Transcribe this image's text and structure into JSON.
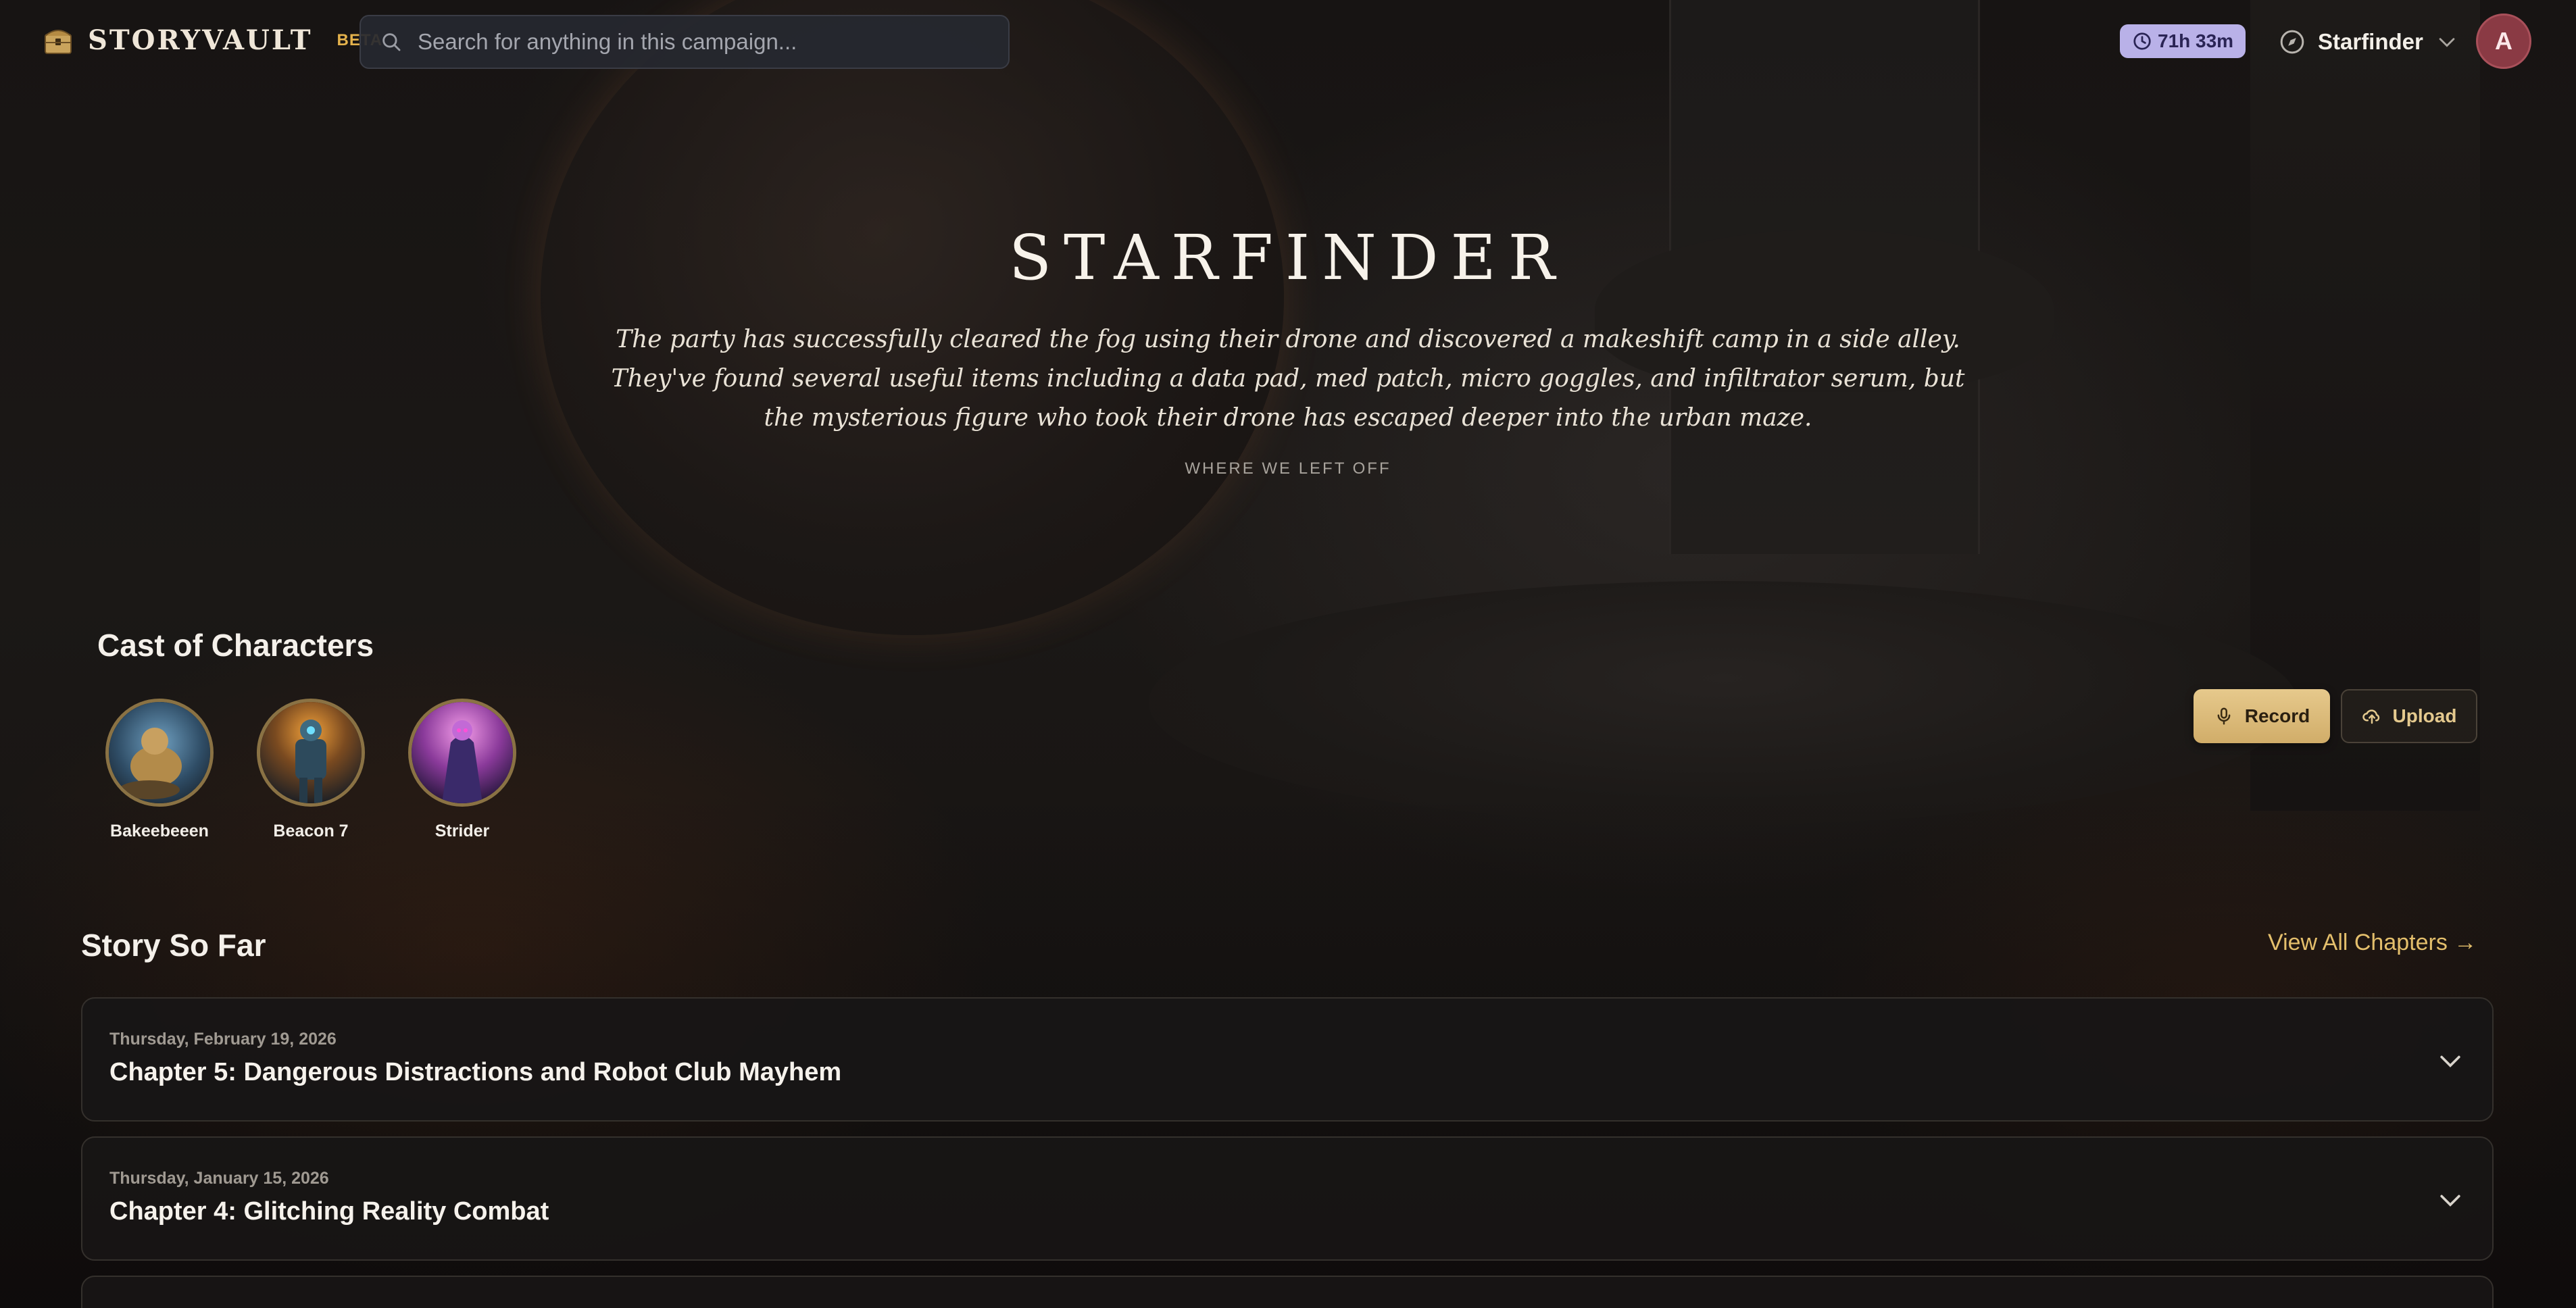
{
  "app": {
    "name": "STORYVAULT",
    "badge": "BETA"
  },
  "search": {
    "placeholder": "Search for anything in this campaign..."
  },
  "header": {
    "time_remaining": "71h 33m",
    "campaign_selector": "Starfinder",
    "user_initial": "A"
  },
  "hero": {
    "title": "STARFINDER",
    "summary": "The party has successfully cleared the fog using their drone and discovered a makeshift camp in a side alley. They've found several useful items including a data pad, med patch, micro goggles, and infiltrator serum, but the mysterious figure who took their drone has escaped deeper into the urban maze.",
    "caption": "WHERE WE LEFT OFF"
  },
  "cast": {
    "heading": "Cast of Characters",
    "characters": [
      {
        "name": "Bakeebeeen"
      },
      {
        "name": "Beacon 7"
      },
      {
        "name": "Strider"
      }
    ]
  },
  "actions": {
    "record": "Record",
    "upload": "Upload"
  },
  "story": {
    "heading": "Story So Far",
    "view_all": "View All Chapters →",
    "chapters": [
      {
        "date": "Thursday, February 19, 2026",
        "title": "Chapter 5: Dangerous Distractions and Robot Club Mayhem"
      },
      {
        "date": "Thursday, January 15, 2026",
        "title": "Chapter 4: Glitching Reality Combat"
      }
    ]
  },
  "colors": {
    "accent_gold": "#e4bf6c",
    "record_button": "#d9b877",
    "timer_badge": "#b9b1e8",
    "avatar": "#8a3a44"
  }
}
